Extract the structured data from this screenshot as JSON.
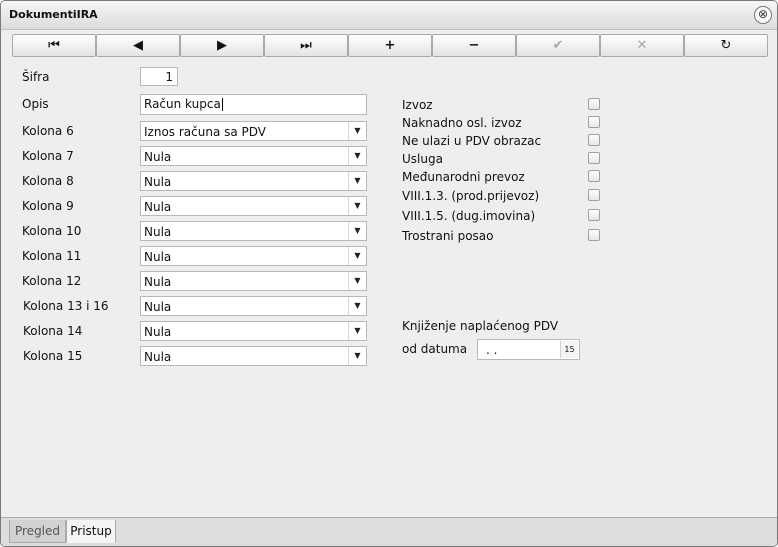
{
  "window": {
    "title": "DokumentiIRA",
    "close_glyph": "⊗"
  },
  "toolbar": {
    "buttons": [
      {
        "name": "first-record",
        "glyph": "⏮"
      },
      {
        "name": "previous-record",
        "glyph": "◀"
      },
      {
        "name": "next-record",
        "glyph": "▶"
      },
      {
        "name": "last-record",
        "glyph": "⏭"
      },
      {
        "name": "add",
        "glyph": "+"
      },
      {
        "name": "remove",
        "glyph": "−"
      },
      {
        "name": "confirm",
        "glyph": "✔"
      },
      {
        "name": "cancel",
        "glyph": "✕"
      },
      {
        "name": "refresh",
        "glyph": "↻"
      }
    ]
  },
  "form": {
    "sifra_label": "Šifra",
    "sifra_value": "1",
    "opis_label": "Opis",
    "opis_value": "Račun kupca",
    "kolone": [
      {
        "label": "Kolona 6",
        "value": "Iznos računa sa PDV"
      },
      {
        "label": "Kolona 7",
        "value": "Nula"
      },
      {
        "label": "Kolona 8",
        "value": "Nula"
      },
      {
        "label": "Kolona 9",
        "value": "Nula"
      },
      {
        "label": "Kolona 10",
        "value": "Nula"
      },
      {
        "label": "Kolona 11",
        "value": "Nula"
      },
      {
        "label": "Kolona 12",
        "value": "Nula"
      },
      {
        "label": "Kolona 13 i 16",
        "value": "Nula"
      },
      {
        "label": "Kolona 14",
        "value": "Nula"
      },
      {
        "label": "Kolona 15",
        "value": "Nula"
      }
    ],
    "checkboxes": [
      {
        "label": "Izvoz",
        "checked": false
      },
      {
        "label": "Naknadno osl. izvoz",
        "checked": false
      },
      {
        "label": "Ne ulazi u PDV obrazac",
        "checked": false
      },
      {
        "label": "Usluga",
        "checked": false
      },
      {
        "label": "Međunarodni prevoz",
        "checked": false
      },
      {
        "label": "VIII.1.3. (prod.prijevoz)",
        "checked": false
      },
      {
        "label": "VIII.1.5. (dug.imovina)",
        "checked": false
      },
      {
        "label": "Trostrani posao",
        "checked": false
      }
    ],
    "knjizenje_label": "Knjiženje naplaćenog PDV",
    "od_datuma_label": "od datuma",
    "od_datuma_value": " .  ."
  },
  "tabs": [
    {
      "label": "Pregled",
      "active": false
    },
    {
      "label": "Pristup",
      "active": true
    }
  ]
}
